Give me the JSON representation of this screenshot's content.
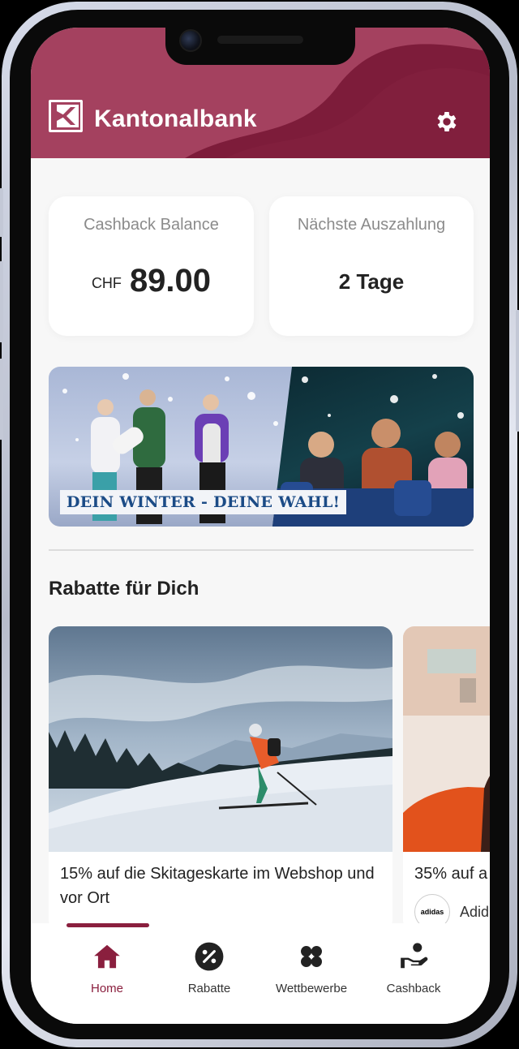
{
  "header": {
    "brand": "Kantonalbank"
  },
  "cards": {
    "balance": {
      "title": "Cashback Balance",
      "currency": "CHF",
      "amount": "89.00"
    },
    "payout": {
      "title": "Nächste Auszahlung",
      "value": "2  Tage"
    }
  },
  "banner": {
    "text": "DEIN WINTER - DEINE WAHL!"
  },
  "section": {
    "title": "Rabatte für Dich"
  },
  "offers": [
    {
      "title": "15% auf die Skitageskarte im Webshop und vor Ort"
    },
    {
      "title": "35% auf a",
      "brand_logo": "adidas",
      "brand": "Adid"
    }
  ],
  "tabs": [
    {
      "label": "Home",
      "icon": "home-icon",
      "active": true
    },
    {
      "label": "Rabatte",
      "icon": "percent-icon",
      "active": false
    },
    {
      "label": "Wettbewerbe",
      "icon": "clover-icon",
      "active": false
    },
    {
      "label": "Cashback",
      "icon": "hand-money-icon",
      "active": false
    }
  ],
  "colors": {
    "primary": "#8a1f3e",
    "header_light": "#a4415f",
    "background": "#f7f7f7"
  }
}
